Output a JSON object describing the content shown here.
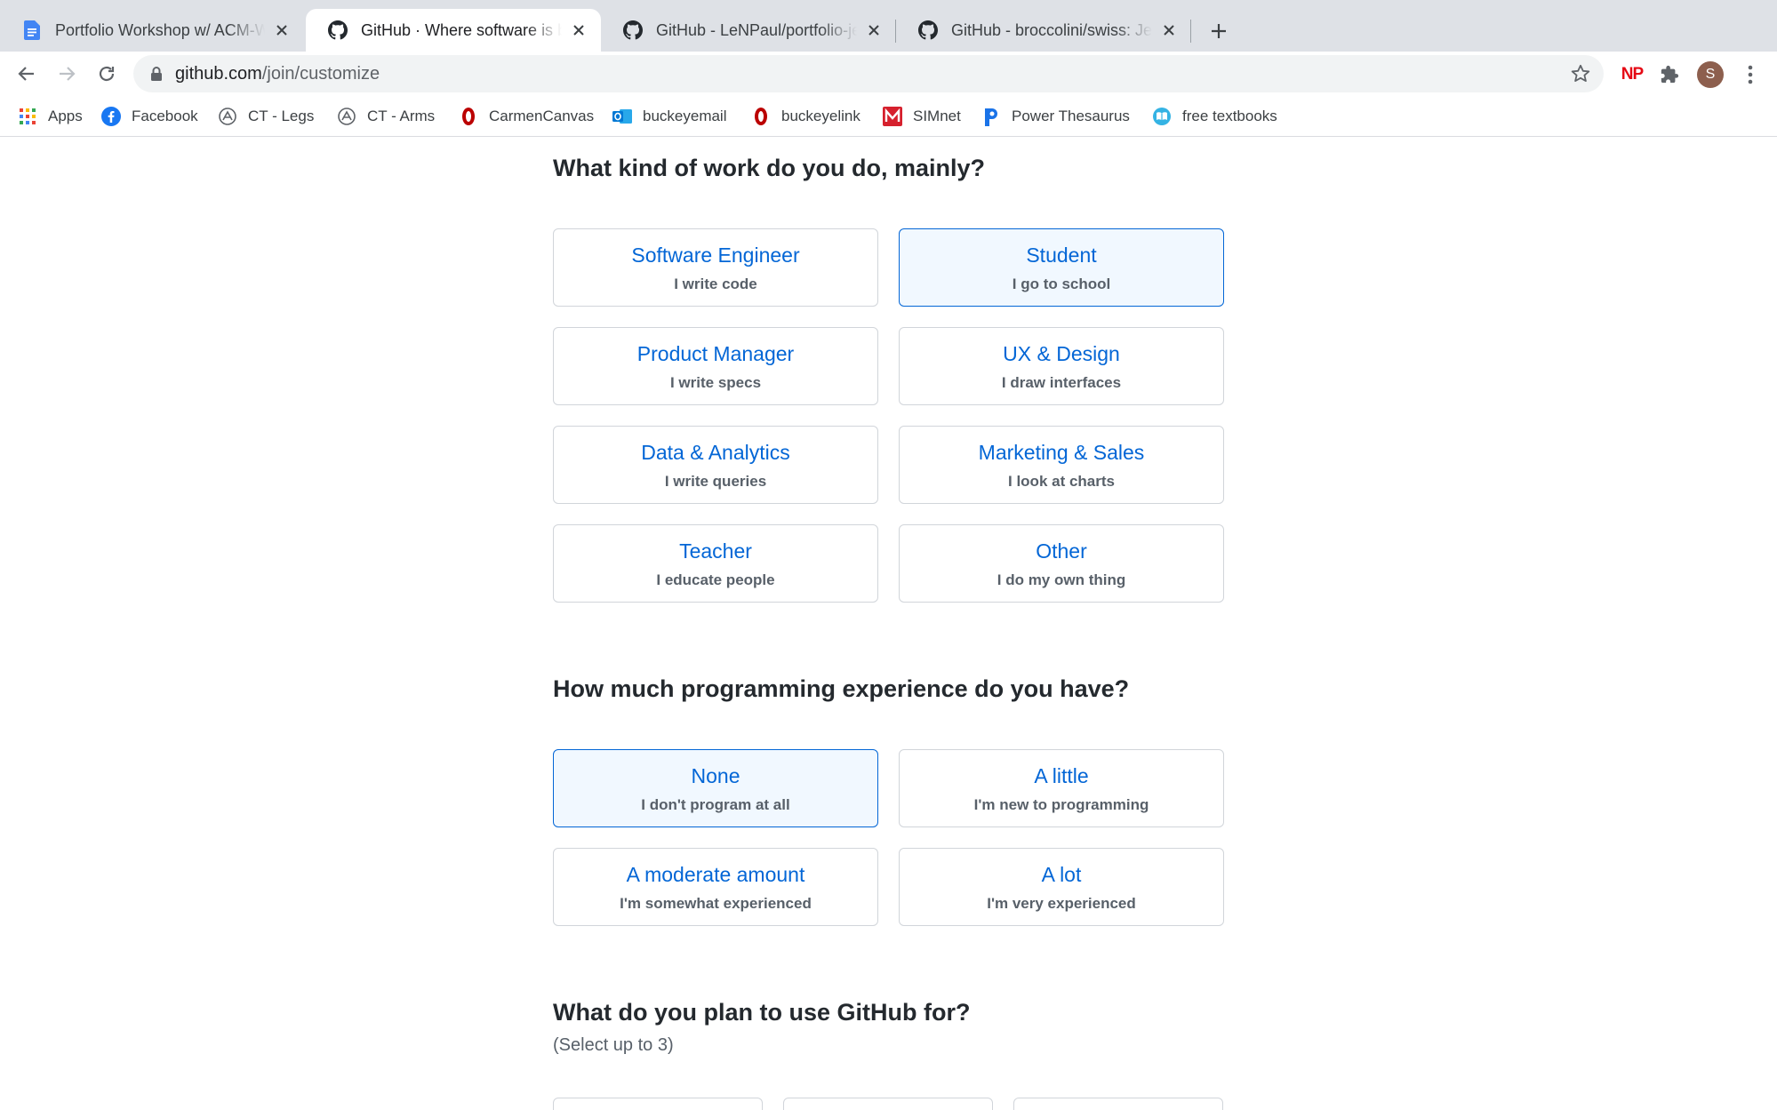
{
  "browser": {
    "tabs": [
      {
        "title": "Portfolio Workshop w/ ACM-W",
        "favicon": "google-docs-icon",
        "active": false
      },
      {
        "title": "GitHub · Where software is built",
        "favicon": "github-icon",
        "active": true
      },
      {
        "title": "GitHub - LeNPaul/portfolio-jekyll",
        "favicon": "github-icon",
        "active": false
      },
      {
        "title": "GitHub - broccolini/swiss: Jekyll",
        "favicon": "github-icon",
        "active": false
      }
    ],
    "url": {
      "host": "github.com",
      "path": "/join/customize"
    },
    "profile_initial": "S",
    "extension_np_label": "NP",
    "bookmarks": [
      {
        "label": "Apps",
        "icon": "apps-grid-icon"
      },
      {
        "label": "Facebook",
        "icon": "facebook-icon"
      },
      {
        "label": "CT - Legs",
        "icon": "ct-icon"
      },
      {
        "label": "CT - Arms",
        "icon": "ct-icon"
      },
      {
        "label": "CarmenCanvas",
        "icon": "osu-icon"
      },
      {
        "label": "buckeyemail",
        "icon": "outlook-icon"
      },
      {
        "label": "buckeyelink",
        "icon": "osu-icon"
      },
      {
        "label": "SIMnet",
        "icon": "mcgraw-hill-icon"
      },
      {
        "label": "Power Thesaurus",
        "icon": "power-thesaurus-icon"
      },
      {
        "label": "free textbooks",
        "icon": "open-book-icon"
      }
    ]
  },
  "colors": {
    "link_blue": "#0366d6",
    "selected_bg": "#f1f8ff",
    "border": "#d1d5da",
    "muted_text": "#586069"
  },
  "survey": {
    "work": {
      "question": "What kind of work do you do, mainly?",
      "options": [
        {
          "title": "Software Engineer",
          "desc": "I write code",
          "selected": false
        },
        {
          "title": "Student",
          "desc": "I go to school",
          "selected": true
        },
        {
          "title": "Product Manager",
          "desc": "I write specs",
          "selected": false
        },
        {
          "title": "UX & Design",
          "desc": "I draw interfaces",
          "selected": false
        },
        {
          "title": "Data & Analytics",
          "desc": "I write queries",
          "selected": false
        },
        {
          "title": "Marketing & Sales",
          "desc": "I look at charts",
          "selected": false
        },
        {
          "title": "Teacher",
          "desc": "I educate people",
          "selected": false
        },
        {
          "title": "Other",
          "desc": "I do my own thing",
          "selected": false
        }
      ]
    },
    "experience": {
      "question": "How much programming experience do you have?",
      "options": [
        {
          "title": "None",
          "desc": "I don't program at all",
          "selected": true
        },
        {
          "title": "A little",
          "desc": "I'm new to programming",
          "selected": false
        },
        {
          "title": "A moderate amount",
          "desc": "I'm somewhat experienced",
          "selected": false
        },
        {
          "title": "A lot",
          "desc": "I'm very experienced",
          "selected": false
        }
      ]
    },
    "uses": {
      "question": "What do you plan to use GitHub for?",
      "hint": "(Select up to 3)"
    }
  }
}
